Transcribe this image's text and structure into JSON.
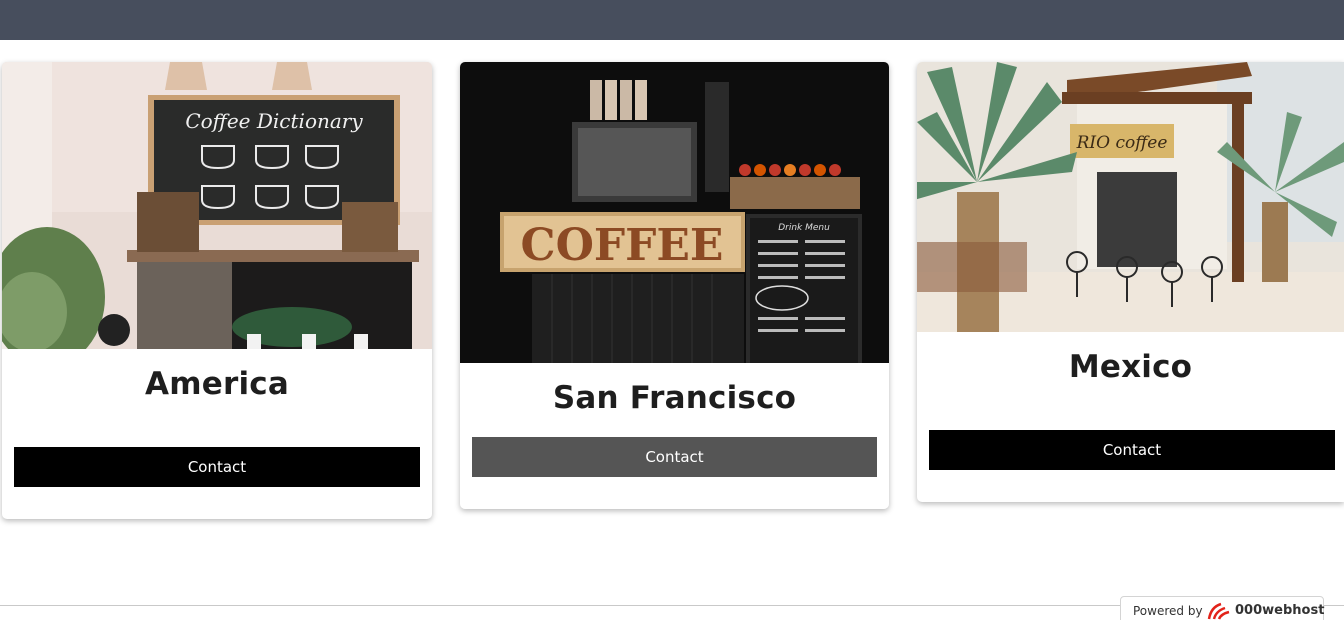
{
  "header": {},
  "cards": [
    {
      "title": "America",
      "button_label": "Contact",
      "image": "coffee-dictionary-chalkboard-photo"
    },
    {
      "title": "San Francisco",
      "button_label": "Contact",
      "image": "coffee-sign-stand-photo"
    },
    {
      "title": "Mexico",
      "button_label": "Contact",
      "image": "rio-coffee-palm-terrace-photo"
    }
  ],
  "footer": {
    "powered_by": "Powered by",
    "brand": "000webhost"
  },
  "image_text": {
    "chalkboard_title": "Coffee Dictionary",
    "coffee_sign": "COFFEE",
    "rio_sign": "RIO coffee",
    "menu_title": "Drink Menu"
  },
  "colors": {
    "topbar": "#474e5d",
    "button": "#000000",
    "button_hover": "#555555"
  }
}
